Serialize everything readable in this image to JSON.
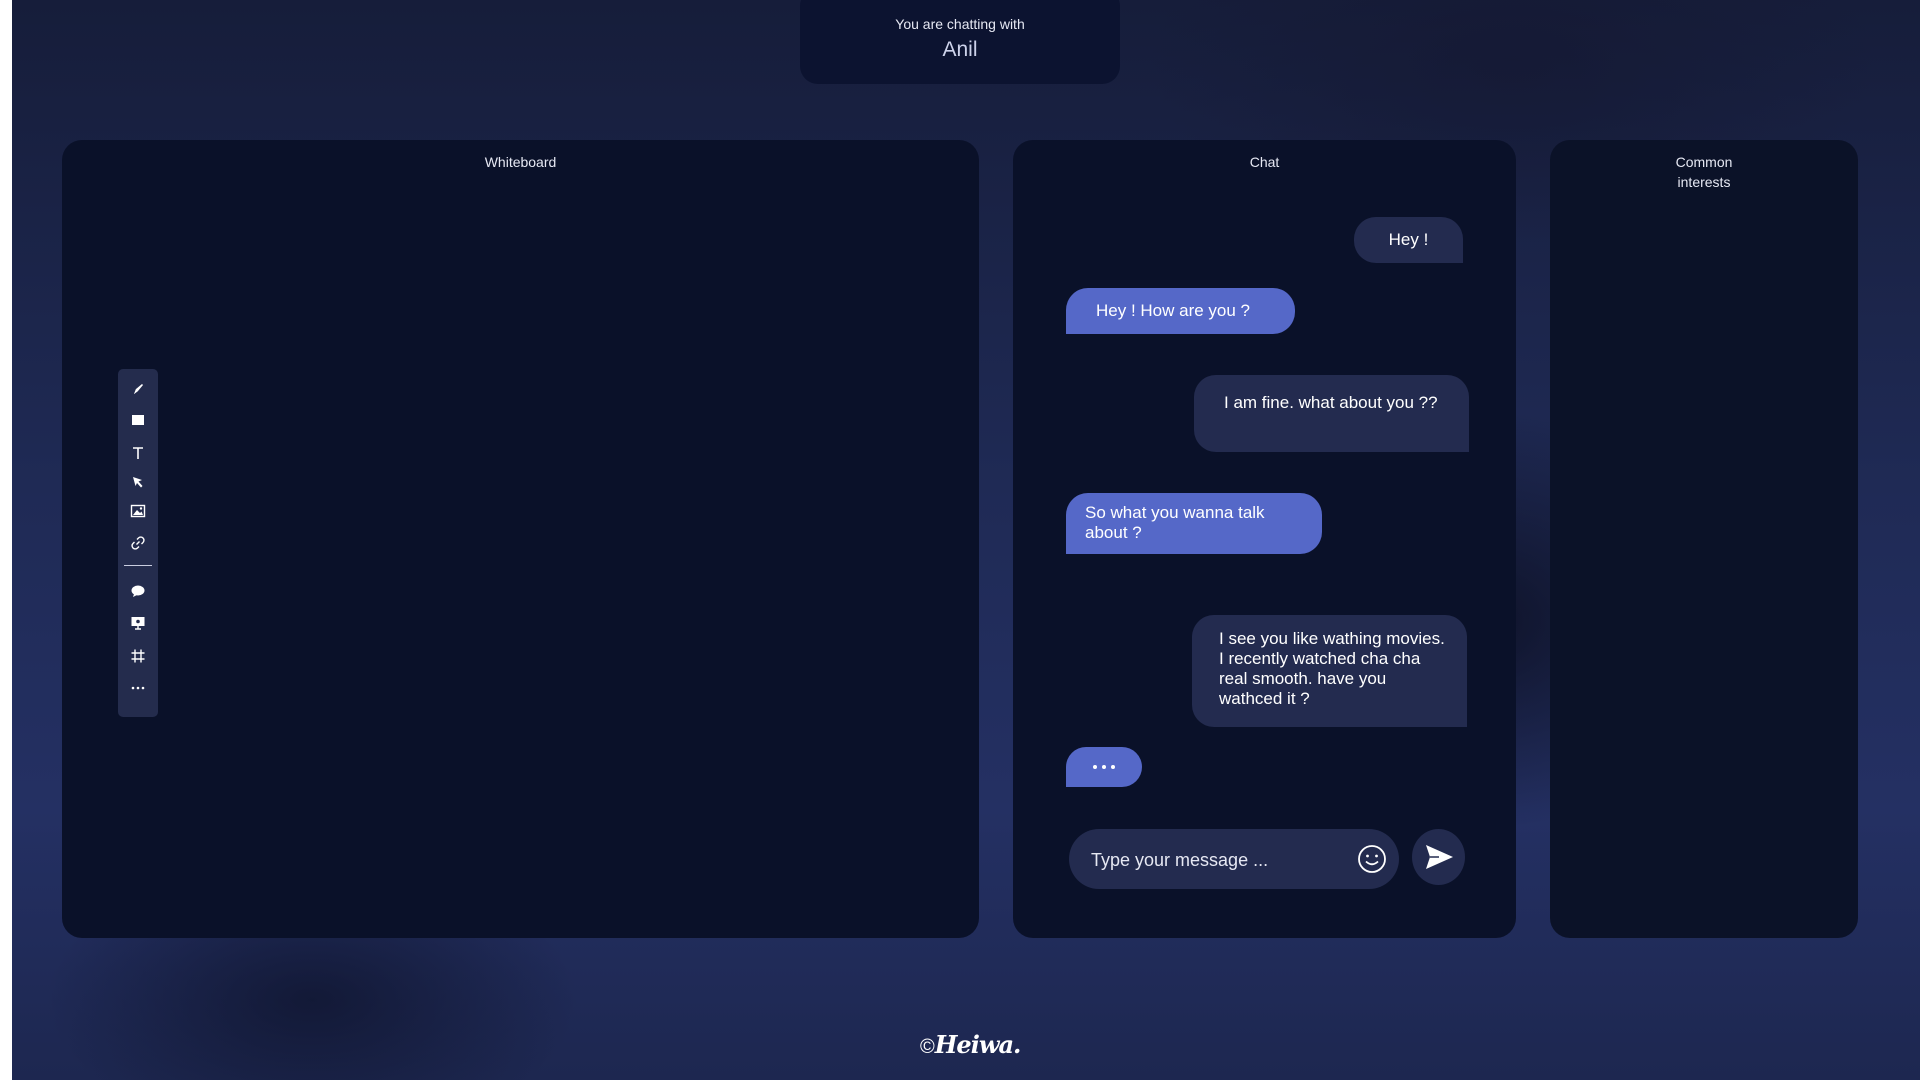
{
  "header": {
    "subtitle": "You are chatting with",
    "name": "Anil"
  },
  "whiteboard": {
    "title": "Whiteboard",
    "tools": [
      "pen-icon",
      "rectangle-icon",
      "text-icon",
      "select-arrow-icon",
      "image-icon",
      "link-icon",
      "comment-icon",
      "present-icon",
      "frame-icon",
      "more-icon"
    ]
  },
  "chat": {
    "title": "Chat",
    "messages": [
      {
        "from": "me",
        "text": "Hey !"
      },
      {
        "from": "them",
        "text": "Hey !  How are you ?"
      },
      {
        "from": "me",
        "text": "I am fine. what about you ??"
      },
      {
        "from": "them",
        "text": "So what you wanna talk about  ?"
      },
      {
        "from": "me",
        "text": "I see you like wathing movies. I recently watched cha cha real smooth. have you wathced it ?"
      }
    ],
    "typing_indicator": "...",
    "input": {
      "placeholder": "Type your message ..."
    },
    "colors": {
      "sent": "#232b4f",
      "received": "#5568c8"
    }
  },
  "interests": {
    "title": "Common interests"
  },
  "footer": {
    "copyright": "©",
    "brand": "Heiwa."
  }
}
